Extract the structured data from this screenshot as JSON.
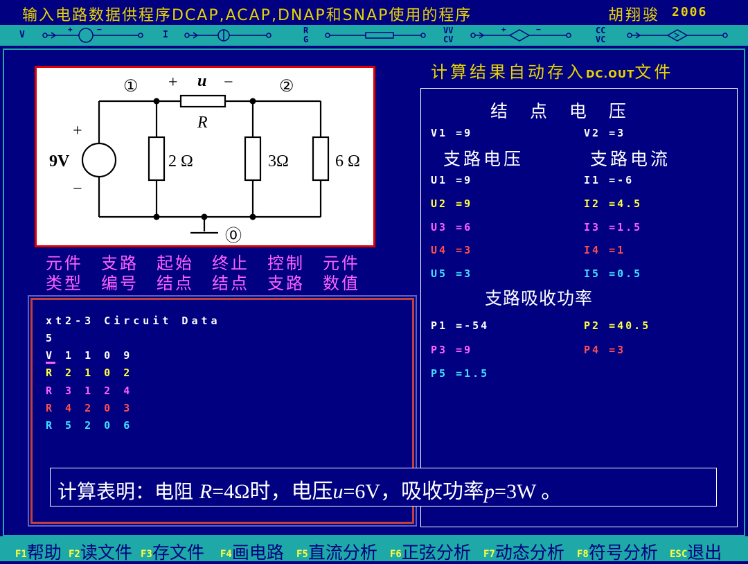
{
  "title": {
    "text": "输入电路数据供程序DCAP,ACAP,DNAP和SNAP使用的程序",
    "author": "胡翔骏",
    "year": "2006"
  },
  "symbol_bar": {
    "items": [
      {
        "label": "V",
        "icon": "voltage-source-icon"
      },
      {
        "label": "I",
        "icon": "current-source-icon"
      },
      {
        "label": "R\nG",
        "icon": "resistor-icon"
      },
      {
        "label": "VV\nCV",
        "icon": "vcvs-icon"
      },
      {
        "label": "CC\nVC",
        "icon": "cccs-icon"
      }
    ]
  },
  "circuit": {
    "node1": "①",
    "node2": "②",
    "node0": "⓪",
    "u_plus": "+",
    "u_label": "u",
    "u_minus": "−",
    "r_label": "R",
    "src_plus": "+",
    "src_value": "9V",
    "src_minus": "−",
    "r2": "2 Ω",
    "r3": "3Ω",
    "r6": "6 Ω"
  },
  "results": {
    "header_cn": "计算结果自动存入",
    "header_file": "DC.OUT",
    "header_cn2": "文件",
    "node_voltage_title": "结 点 电 压",
    "node_voltages": [
      "V1 =9",
      "V2 =3"
    ],
    "branch_voltage_title": "支路电压",
    "branch_current_title": "支路电流",
    "branch_voltages": [
      "U1 =9",
      "U2 =9",
      "U3 =6",
      "U4 =3",
      "U5 =3"
    ],
    "branch_currents": [
      "I1 =-6",
      "I2 =4.5",
      "I3 =1.5",
      "I4 =1",
      "I5 =0.5"
    ],
    "power_title": "支路吸收功率",
    "powers": [
      "P1 =-54",
      "P2 =40.5",
      "P3 =9",
      "P4 =3",
      "P5 =1.5"
    ]
  },
  "field_labels": {
    "row1": [
      "元件",
      "支路",
      "起始",
      "终止",
      "控制",
      "元件"
    ],
    "row2": [
      "类型",
      "编号",
      "结点",
      "结点",
      "支路",
      "数值"
    ]
  },
  "data_file": {
    "title": "xt2-3 Circuit Data",
    "count": "5",
    "lines": [
      "V 1 1 0 9",
      "R 2 1 0 2",
      "R 3 1 2 4",
      "R 4 2 0 3",
      "R 5 2 0 6"
    ]
  },
  "note": {
    "prefix": "计算表明：电阻 ",
    "r_sym": "R",
    "r_val": "=4Ω时，电压",
    "u_sym": "u",
    "u_val": "=6V，吸收功率",
    "p_sym": "p",
    "p_val": "=3W 。"
  },
  "function_keys": [
    {
      "key": "F1",
      "label": "帮助"
    },
    {
      "key": "F2",
      "label": "读文件"
    },
    {
      "key": "F3",
      "label": "存文件"
    },
    {
      "key": "F4",
      "label": "画电路"
    },
    {
      "key": "F5",
      "label": "直流分析"
    },
    {
      "key": "F6",
      "label": "正弦分析"
    },
    {
      "key": "F7",
      "label": "动态分析"
    },
    {
      "key": "F8",
      "label": "符号分析"
    },
    {
      "key": "ESC",
      "label": "退出"
    }
  ],
  "colors": {
    "background": "#000080",
    "accent_bar": "#1fa8a8",
    "title_yellow": "#e8d400",
    "white": "#ffffff",
    "yellow": "#ffff40",
    "magenta": "#ff60ff",
    "red": "#ff5050",
    "cyan": "#40e0ff"
  }
}
